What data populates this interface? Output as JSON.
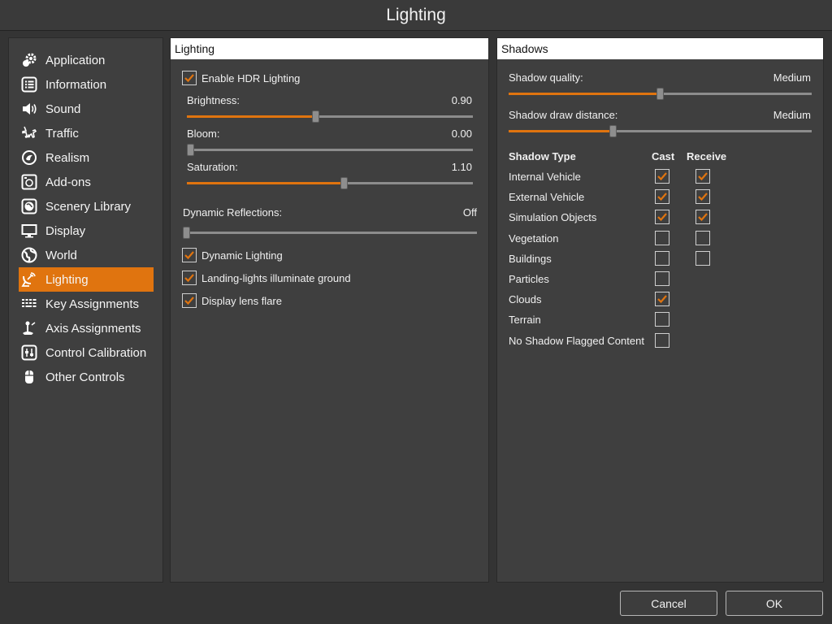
{
  "window": {
    "title": "Lighting"
  },
  "sidebar": {
    "items": [
      {
        "label": "Application",
        "icon": "gears-icon"
      },
      {
        "label": "Information",
        "icon": "list-icon"
      },
      {
        "label": "Sound",
        "icon": "speaker-icon"
      },
      {
        "label": "Traffic",
        "icon": "airplanes-icon"
      },
      {
        "label": "Realism",
        "icon": "realism-icon"
      },
      {
        "label": "Add-ons",
        "icon": "addons-icon"
      },
      {
        "label": "Scenery Library",
        "icon": "globe-square-icon"
      },
      {
        "label": "Display",
        "icon": "monitor-icon"
      },
      {
        "label": "World",
        "icon": "globe-icon"
      },
      {
        "label": "Lighting",
        "icon": "dish-icon",
        "active": true
      },
      {
        "label": "Key Assignments",
        "icon": "keyboard-icon"
      },
      {
        "label": "Axis Assignments",
        "icon": "joystick-icon"
      },
      {
        "label": "Control Calibration",
        "icon": "calibration-icon"
      },
      {
        "label": "Other Controls",
        "icon": "mouse-icon"
      }
    ]
  },
  "lighting": {
    "header": "Lighting",
    "enable_hdr": {
      "label": "Enable HDR Lighting",
      "checked": true
    },
    "brightness": {
      "label": "Brightness:",
      "value": "0.90",
      "fraction": 0.45
    },
    "bloom": {
      "label": "Bloom:",
      "value": "0.00",
      "fraction": 0.0
    },
    "saturation": {
      "label": "Saturation:",
      "value": "1.10",
      "fraction": 0.55
    },
    "dynamic_reflections": {
      "label": "Dynamic Reflections:",
      "value": "Off",
      "fraction": 0.0
    },
    "dynamic_lighting": {
      "label": "Dynamic Lighting",
      "checked": true
    },
    "landing_lights": {
      "label": "Landing-lights illuminate ground",
      "checked": true
    },
    "lens_flare": {
      "label": "Display lens flare",
      "checked": true
    }
  },
  "shadows": {
    "header": "Shadows",
    "quality": {
      "label": "Shadow quality:",
      "value": "Medium",
      "fraction": 0.5
    },
    "distance": {
      "label": "Shadow draw distance:",
      "value": "Medium",
      "fraction": 0.34
    },
    "table": {
      "col_type": "Shadow Type",
      "col_cast": "Cast",
      "col_receive": "Receive",
      "rows": [
        {
          "label": "Internal Vehicle",
          "cast": true,
          "receive": true
        },
        {
          "label": "External Vehicle",
          "cast": true,
          "receive": true
        },
        {
          "label": "Simulation Objects",
          "cast": true,
          "receive": true
        },
        {
          "label": "Vegetation",
          "cast": false,
          "receive": false
        },
        {
          "label": "Buildings",
          "cast": false,
          "receive": false
        },
        {
          "label": "Particles",
          "cast": false,
          "receive": null
        },
        {
          "label": "Clouds",
          "cast": true,
          "receive": null
        },
        {
          "label": "Terrain",
          "cast": false,
          "receive": null
        },
        {
          "label": "No Shadow Flagged Content",
          "cast": false,
          "receive": null
        }
      ]
    }
  },
  "buttons": {
    "cancel": "Cancel",
    "ok": "OK"
  },
  "colors": {
    "accent": "#e0740f",
    "background": "#343434",
    "panel": "#3f3f3f"
  }
}
